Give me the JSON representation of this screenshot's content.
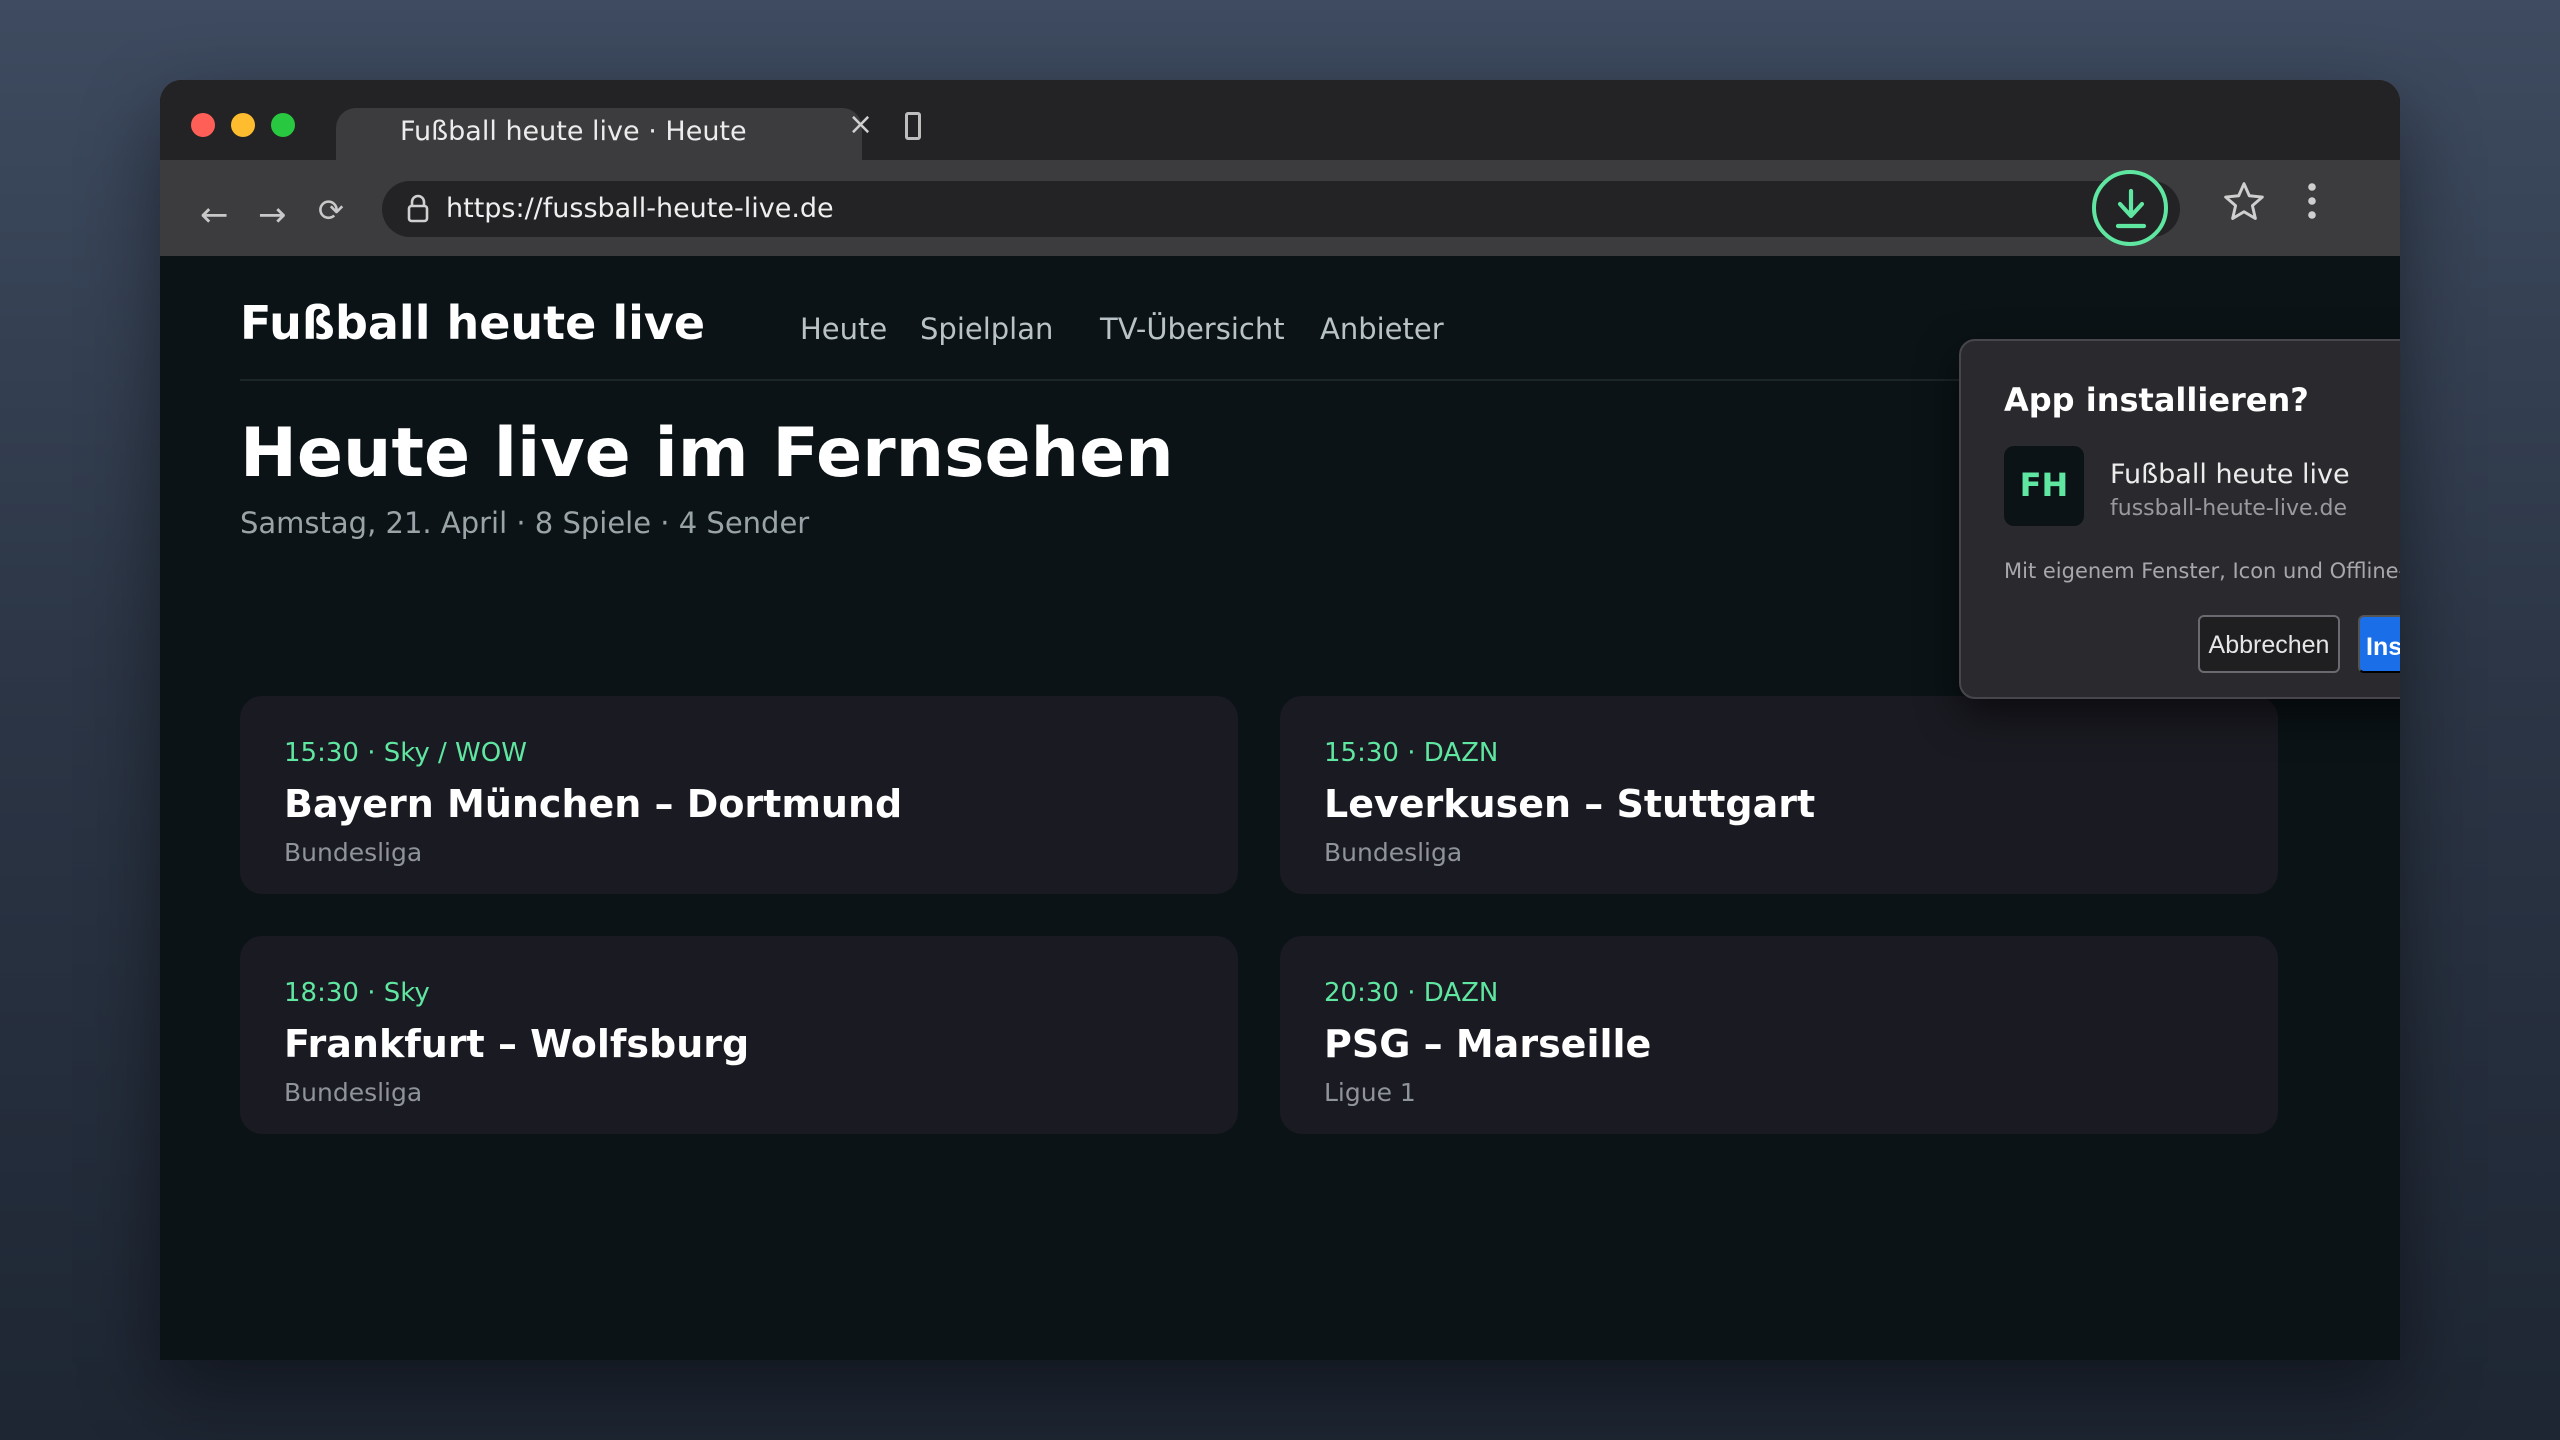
{
  "browser": {
    "tab_title": "Fußball heute live · Heute",
    "tab_close": "×",
    "back": "←",
    "forward": "→",
    "reload": "⟳",
    "url": "https://fussball-heute-live.de"
  },
  "site": {
    "brand": "Fußball heute live",
    "nav": [
      "Heute",
      "Spielplan",
      "TV-Übersicht",
      "Anbieter"
    ],
    "headline": "Heute live im Fernsehen",
    "subline": "Samstag, 21. April · 8 Spiele · 4 Sender",
    "matches": [
      {
        "meta": "15:30 · Sky / WOW",
        "title": "Bayern München – Dortmund",
        "league": "Bundesliga"
      },
      {
        "meta": "15:30 · DAZN",
        "title": "Leverkusen – Stuttgart",
        "league": "Bundesliga"
      },
      {
        "meta": "18:30 · Sky",
        "title": "Frankfurt – Wolfsburg",
        "league": "Bundesliga"
      },
      {
        "meta": "20:30 · DAZN",
        "title": "PSG – Marseille",
        "league": "Ligue 1"
      }
    ]
  },
  "install_popup": {
    "title": "App installieren?",
    "app_icon_text": "FH",
    "app_name": "Fußball heute live",
    "app_domain": "fussball-heute-live.de",
    "description": "Mit eigenem Fenster, Icon und Offline-Spielplan.",
    "cancel_label": "Abbrechen",
    "install_label": "Installieren"
  },
  "colors": {
    "accent": "#5fe6a0",
    "primary_button": "#1a6fe8",
    "page_background": "#0b1316",
    "card_background": "#1a1a22"
  },
  "icons": [
    "lock-icon",
    "download-icon",
    "star-icon",
    "menu-icon",
    "newtab-icon"
  ]
}
